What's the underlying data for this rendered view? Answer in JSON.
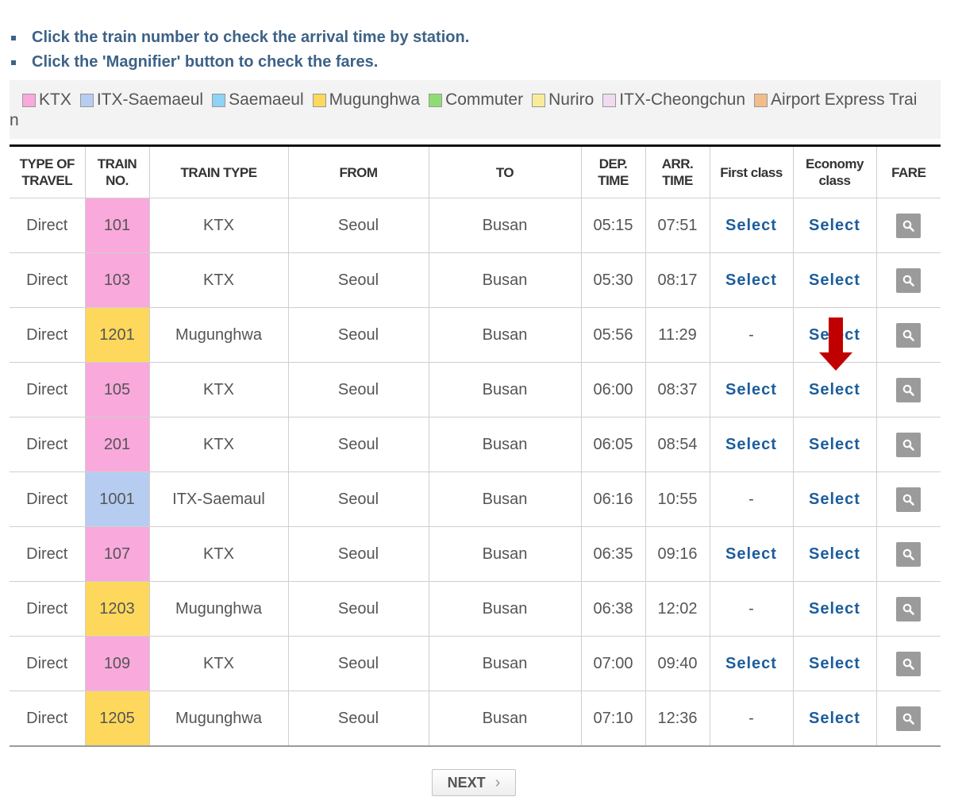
{
  "notes": [
    "Click the train number to check the arrival time by station.",
    "Click the 'Magnifier' button to check the fares."
  ],
  "legend": [
    {
      "label": "KTX",
      "color": "#f9a9dc"
    },
    {
      "label": "ITX-Saemaeul",
      "color": "#b6cdf1"
    },
    {
      "label": "Saemaeul",
      "color": "#8ed2f4"
    },
    {
      "label": "Mugunghwa",
      "color": "#fdd85c"
    },
    {
      "label": "Commuter",
      "color": "#8edd74"
    },
    {
      "label": "Nuriro",
      "color": "#f8ec9a"
    },
    {
      "label": "ITX-Cheongchun",
      "color": "#f0dbf0"
    },
    {
      "label": "Airport Express Trai",
      "color": "#f3bd8a"
    }
  ],
  "legend_wrap": "n",
  "headers": {
    "type_of_travel": [
      "TYPE OF",
      "TRAVEL"
    ],
    "train_no": [
      "TRAIN",
      "NO."
    ],
    "train_type": "TRAIN TYPE",
    "from": "FROM",
    "to": "TO",
    "dep_time": [
      "DEP.",
      "TIME"
    ],
    "arr_time": [
      "ARR.",
      "TIME"
    ],
    "first_class": "First class",
    "economy_class": [
      "Economy",
      "class"
    ],
    "fare": "FARE"
  },
  "colors": {
    "KTX": "#f9a9dc",
    "Mugunghwa": "#fdd85c",
    "ITX-Saemaul": "#b6cdf1",
    "link": "#1c5d9c",
    "arrow": "#c00000"
  },
  "rows": [
    {
      "travel": "Direct",
      "no": "101",
      "type": "KTX",
      "from": "Seoul",
      "to": "Busan",
      "dep": "05:15",
      "arr": "07:51",
      "first": "Select",
      "economy": "Select"
    },
    {
      "travel": "Direct",
      "no": "103",
      "type": "KTX",
      "from": "Seoul",
      "to": "Busan",
      "dep": "05:30",
      "arr": "08:17",
      "first": "Select",
      "economy": "Select"
    },
    {
      "travel": "Direct",
      "no": "1201",
      "type": "Mugunghwa",
      "from": "Seoul",
      "to": "Busan",
      "dep": "05:56",
      "arr": "11:29",
      "first": "-",
      "economy": "Select"
    },
    {
      "travel": "Direct",
      "no": "105",
      "type": "KTX",
      "from": "Seoul",
      "to": "Busan",
      "dep": "06:00",
      "arr": "08:37",
      "first": "Select",
      "economy": "Select"
    },
    {
      "travel": "Direct",
      "no": "201",
      "type": "KTX",
      "from": "Seoul",
      "to": "Busan",
      "dep": "06:05",
      "arr": "08:54",
      "first": "Select",
      "economy": "Select"
    },
    {
      "travel": "Direct",
      "no": "1001",
      "type": "ITX-Saemaul",
      "from": "Seoul",
      "to": "Busan",
      "dep": "06:16",
      "arr": "10:55",
      "first": "-",
      "economy": "Select"
    },
    {
      "travel": "Direct",
      "no": "107",
      "type": "KTX",
      "from": "Seoul",
      "to": "Busan",
      "dep": "06:35",
      "arr": "09:16",
      "first": "Select",
      "economy": "Select"
    },
    {
      "travel": "Direct",
      "no": "1203",
      "type": "Mugunghwa",
      "from": "Seoul",
      "to": "Busan",
      "dep": "06:38",
      "arr": "12:02",
      "first": "-",
      "economy": "Select"
    },
    {
      "travel": "Direct",
      "no": "109",
      "type": "KTX",
      "from": "Seoul",
      "to": "Busan",
      "dep": "07:00",
      "arr": "09:40",
      "first": "Select",
      "economy": "Select"
    },
    {
      "travel": "Direct",
      "no": "1205",
      "type": "Mugunghwa",
      "from": "Seoul",
      "to": "Busan",
      "dep": "07:10",
      "arr": "12:36",
      "first": "-",
      "economy": "Select"
    }
  ],
  "fare_icon": "magnifier-icon",
  "next_label": "NEXT",
  "next_icon": "chevron-right-icon"
}
